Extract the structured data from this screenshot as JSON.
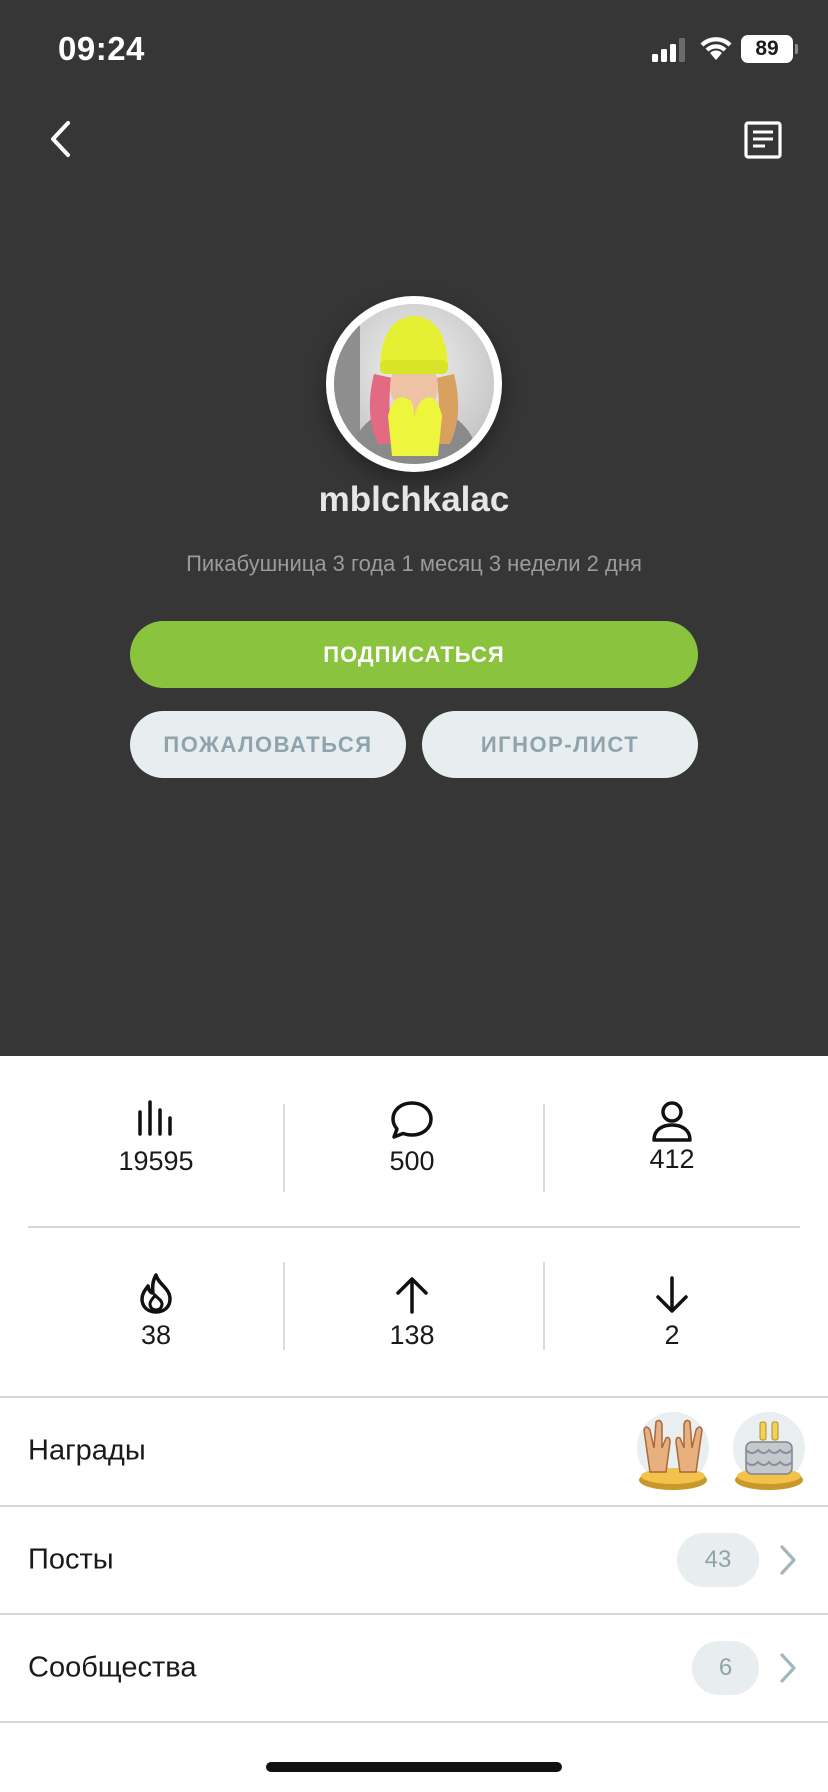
{
  "status_bar": {
    "time": "09:24",
    "battery": "89"
  },
  "profile": {
    "username": "mblchkalac",
    "member_since": "Пикабушница 3 года 1 месяц 3 недели 2 дня"
  },
  "buttons": {
    "subscribe": "ПОДПИСАТЬСЯ",
    "report": "ПОЖАЛОВАТЬСЯ",
    "ignore": "ИГНОР-ЛИСТ"
  },
  "stats": {
    "rating": {
      "icon": "bar-chart-icon",
      "value": "19595"
    },
    "comments": {
      "icon": "comment-bubble-icon",
      "value": "500"
    },
    "subscribers": {
      "icon": "person-icon",
      "value": "412"
    },
    "hot": {
      "icon": "flame-icon",
      "value": "38"
    },
    "pluses": {
      "icon": "arrow-up-icon",
      "value": "138"
    },
    "minuses": {
      "icon": "arrow-down-icon",
      "value": "2"
    }
  },
  "rows": {
    "awards": {
      "label": "Награды",
      "icons": [
        "raised-hands-award-icon",
        "cake-award-icon"
      ]
    },
    "posts": {
      "label": "Посты",
      "count": "43"
    },
    "communities": {
      "label": "Сообщества",
      "count": "6"
    }
  },
  "colors": {
    "header_bg": "#363636",
    "accent_green": "#8ac43f",
    "pill_bg": "#e8eef0",
    "pill_text": "#8ea3ac"
  }
}
